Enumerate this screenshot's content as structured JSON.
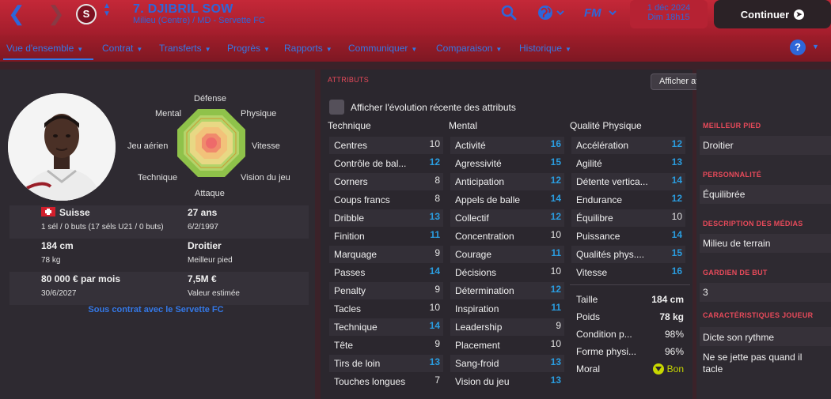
{
  "header": {
    "player_name": "7. DJIBRIL SOW",
    "player_sub": "Milieu (Centre) / MD - Servette FC",
    "club_badge": "S",
    "date_line1": "1 déc 2024",
    "date_line2": "Dim 18h15",
    "continue_label": "Continuer",
    "fm_label": "FM",
    "accent_color": "#2e66d9",
    "bar_color": "#c42838"
  },
  "tabs": [
    {
      "label": "Vue d'ensemble"
    },
    {
      "label": "Contrat"
    },
    {
      "label": "Transferts"
    },
    {
      "label": "Progrès"
    },
    {
      "label": "Rapports"
    },
    {
      "label": "Communiquer"
    },
    {
      "label": "Comparaison"
    },
    {
      "label": "Historique"
    }
  ],
  "help_label": "?",
  "radar": {
    "defense": "Défense",
    "physique": "Physique",
    "vitesse": "Vitesse",
    "vision": "Vision du jeu",
    "attaque": "Attaque",
    "technique": "Technique",
    "jeu_aerien": "Jeu aérien",
    "mental": "Mental"
  },
  "info": {
    "nationality": "Suisse",
    "caps": "1 sél / 0 buts (17 séls U21 / 0 buts)",
    "age": "27 ans",
    "dob": "6/2/1997",
    "height": "184 cm",
    "weight": "78 kg",
    "foot": "Droitier",
    "foot_label": "Meilleur pied",
    "wage": "80 000 € par mois",
    "contract_end": "30/6/2027",
    "value": "7,5M €",
    "value_label": "Valeur estimée",
    "contract_link": "Sous contrat avec le Servette FC"
  },
  "attributes": {
    "section_title": "ATTRIBUTS",
    "key_button": "Afficher attributs clés pour rôle",
    "checkbox_label": "Afficher l'évolution récente des attributs",
    "technique_head": "Technique",
    "mental_head": "Mental",
    "physical_head": "Qualité Physique",
    "technique": [
      {
        "name": "Centres",
        "value": "10"
      },
      {
        "name": "Contrôle de bal...",
        "value": "12"
      },
      {
        "name": "Corners",
        "value": "8"
      },
      {
        "name": "Coups francs",
        "value": "8"
      },
      {
        "name": "Dribble",
        "value": "13"
      },
      {
        "name": "Finition",
        "value": "11"
      },
      {
        "name": "Marquage",
        "value": "9"
      },
      {
        "name": "Passes",
        "value": "14"
      },
      {
        "name": "Penalty",
        "value": "9"
      },
      {
        "name": "Tacles",
        "value": "10"
      },
      {
        "name": "Technique",
        "value": "14"
      },
      {
        "name": "Tête",
        "value": "9"
      },
      {
        "name": "Tirs de loin",
        "value": "13"
      },
      {
        "name": "Touches longues",
        "value": "7"
      }
    ],
    "mental": [
      {
        "name": "Activité",
        "value": "16"
      },
      {
        "name": "Agressivité",
        "value": "15"
      },
      {
        "name": "Anticipation",
        "value": "12"
      },
      {
        "name": "Appels de balle",
        "value": "14"
      },
      {
        "name": "Collectif",
        "value": "12"
      },
      {
        "name": "Concentration",
        "value": "10"
      },
      {
        "name": "Courage",
        "value": "11"
      },
      {
        "name": "Décisions",
        "value": "10"
      },
      {
        "name": "Détermination",
        "value": "12"
      },
      {
        "name": "Inspiration",
        "value": "11"
      },
      {
        "name": "Leadership",
        "value": "9"
      },
      {
        "name": "Placement",
        "value": "10"
      },
      {
        "name": "Sang-froid",
        "value": "13"
      },
      {
        "name": "Vision du jeu",
        "value": "13"
      }
    ],
    "physical": [
      {
        "name": "Accélération",
        "value": "12"
      },
      {
        "name": "Agilité",
        "value": "13"
      },
      {
        "name": "Détente vertica...",
        "value": "14"
      },
      {
        "name": "Endurance",
        "value": "12"
      },
      {
        "name": "Équilibre",
        "value": "10"
      },
      {
        "name": "Puissance",
        "value": "14"
      },
      {
        "name": "Qualités phys....",
        "value": "15"
      },
      {
        "name": "Vitesse",
        "value": "16"
      }
    ],
    "extra": [
      {
        "name": "Taille",
        "value": "184 cm"
      },
      {
        "name": "Poids",
        "value": "78 kg"
      },
      {
        "name": "Condition p...",
        "value": "98%"
      },
      {
        "name": "Forme physi...",
        "value": "96%"
      },
      {
        "name": "Moral",
        "value": "Bon"
      }
    ]
  },
  "right": {
    "foot_title": "MEILLEUR PIED",
    "foot_value": "Droitier",
    "personality_title": "PERSONNALITÉ",
    "personality_value": "Équilibrée",
    "media_title": "DESCRIPTION DES MÉDIAS",
    "media_value": "Milieu de terrain",
    "keeper_title": "GARDIEN DE BUT",
    "keeper_value": "3",
    "traits_title": "CARACTÉRISTIQUES JOUEUR",
    "traits": [
      "Dicte son rythme",
      "Ne se jette pas quand il tacle"
    ]
  },
  "icons": {
    "back": "chevron-left-icon",
    "forward": "chevron-right-icon",
    "search": "search-icon",
    "world": "globe-icon",
    "continue": "arrow-right-circle-icon",
    "flag": "swiss-flag-icon",
    "moral": "morale-icon"
  }
}
